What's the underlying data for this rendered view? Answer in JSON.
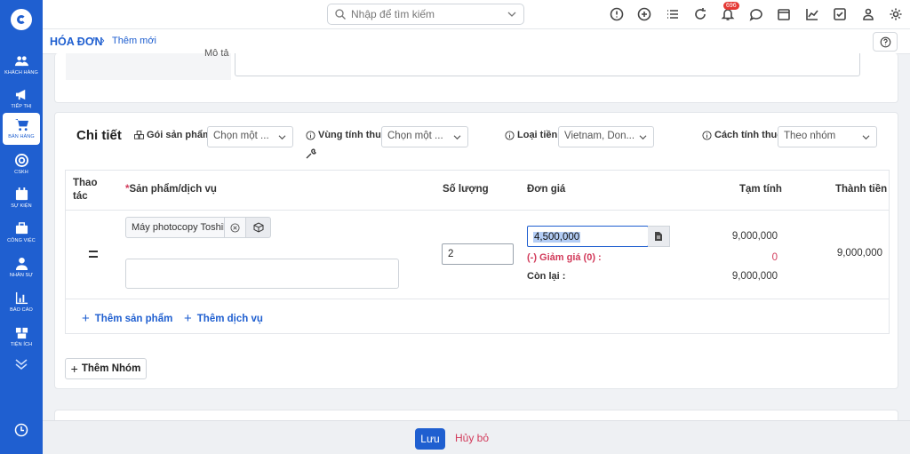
{
  "sidebar": {
    "items": [
      {
        "label": "KHÁCH HÀNG",
        "icon": "users-icon"
      },
      {
        "label": "TIẾP THỊ",
        "icon": "megaphone-icon"
      },
      {
        "label": "BÁN HÀNG",
        "icon": "cart-icon"
      },
      {
        "label": "CSKH",
        "icon": "lifebuoy-icon"
      },
      {
        "label": "SỰ KIỆN",
        "icon": "calendar-icon"
      },
      {
        "label": "CÔNG VIỆC",
        "icon": "briefcase-icon"
      },
      {
        "label": "NHÂN SỰ",
        "icon": "person-icon"
      },
      {
        "label": "BÁO CÁO",
        "icon": "bar-chart-icon"
      },
      {
        "label": "TIỆN ÍCH",
        "icon": "boxes-icon"
      }
    ],
    "active_index": 2
  },
  "topbar": {
    "search_placeholder": "Nhập để tìm kiếm",
    "notification_count": "696"
  },
  "breadcrumb": {
    "main": "HÓA ĐƠN",
    "separator": "›",
    "sub": "Thêm mới"
  },
  "description": {
    "label": "Mô tả"
  },
  "detail": {
    "title": "Chi tiết",
    "filters": {
      "package_label": "Gói sản phẩm",
      "package_value": "Chọn một ...",
      "tax_region_label": "Vùng tính thuế",
      "tax_region_value": "Chọn một ...",
      "currency_label": "Loại tiền",
      "currency_value": "Vietnam, Don...",
      "calc_label": "Cách tính thuế",
      "calc_value": "Theo nhóm"
    },
    "table": {
      "headers": {
        "action_line1": "Thao",
        "action_line2": "tác",
        "product_required": "*",
        "product": "Sản phẩm/dịch vụ",
        "quantity": "Số lượng",
        "unit_price": "Đơn giá",
        "subtotal": "Tạm tính",
        "total": "Thành tiền"
      },
      "row": {
        "product": "Máy photocopy Toshiba",
        "quantity": "2",
        "unit_price": "4,500,000",
        "discount_label": "(-) Giảm giá (0) :",
        "remaining_label": "Còn lại :",
        "subtotal": "9,000,000",
        "discount_value": "0",
        "remaining_value": "9,000,000",
        "total": "9,000,000"
      },
      "add_product": "Thêm sản phẩm",
      "add_service": "Thêm dịch vụ"
    },
    "add_group": "Thêm Nhóm"
  },
  "footer": {
    "save": "Lưu",
    "cancel": "Hủy bỏ"
  },
  "colors": {
    "primary": "#1f5fd0",
    "danger": "#d23a5a"
  }
}
